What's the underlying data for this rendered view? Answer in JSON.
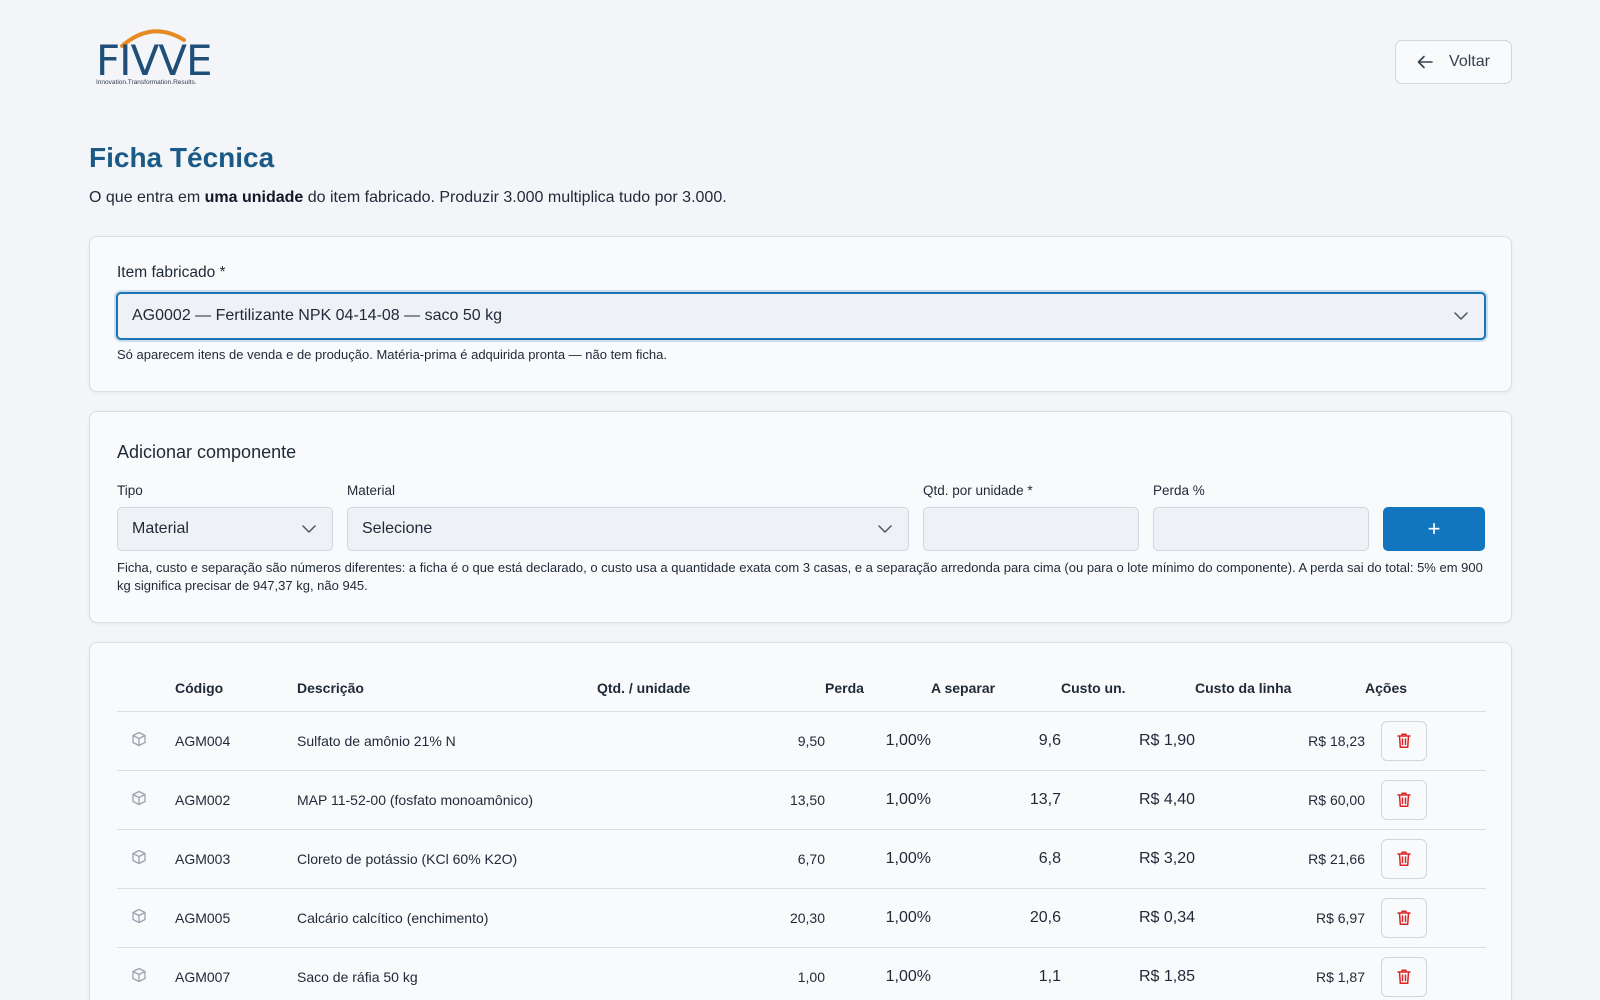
{
  "brand": {
    "logo_text": "FIVVE",
    "tagline": "Innovation.Transformation.Results.",
    "accent_color": "#e88a24",
    "primary_color": "#1b5a87"
  },
  "header": {
    "back_label": "Voltar",
    "back_icon": "arrow-left-icon"
  },
  "page": {
    "title": "Ficha Técnica",
    "subtitle_pre": "O que entra em ",
    "subtitle_bold": "uma unidade",
    "subtitle_post": " do item fabricado. Produzir 3.000 multiplica tudo por 3.000."
  },
  "item_select": {
    "label": "Item fabricado *",
    "value": "AG0002 — Fertilizante NPK 04-14-08 — saco 50 kg",
    "hint": "Só aparecem itens de venda e de produção. Matéria-prima é adquirida pronta — não tem ficha."
  },
  "add_component": {
    "title": "Adicionar componente",
    "tipo_label": "Tipo",
    "tipo_value": "Material",
    "material_label": "Material",
    "material_value": "Selecione",
    "qtd_label": "Qtd. por unidade *",
    "qtd_value": "",
    "perda_label": "Perda %",
    "perda_value": "",
    "add_button": "+",
    "hint": "Ficha, custo e separação são números diferentes: a ficha é o que está declarado, o custo usa a quantidade exata com 3 casas, e a separação arredonda para cima (ou para o lote mínimo do componente). A perda sai do total: 5% em 900 kg significa precisar de 947,37 kg, não 945."
  },
  "table": {
    "columns": [
      "Código",
      "Descrição",
      "Qtd. / unidade",
      "Perda",
      "A separar",
      "Custo un.",
      "Custo da linha",
      "Ações"
    ],
    "rows": [
      {
        "icon": "box-icon",
        "code": "AGM004",
        "desc": "Sulfato de amônio 21% N",
        "qtd": "9,50",
        "perda": "1,00%",
        "separar": "9,6",
        "custo_un": "R$ 1,90",
        "custo_linha": "R$ 18,23"
      },
      {
        "icon": "box-icon",
        "code": "AGM002",
        "desc": "MAP 11-52-00 (fosfato monoamônico)",
        "qtd": "13,50",
        "perda": "1,00%",
        "separar": "13,7",
        "custo_un": "R$ 4,40",
        "custo_linha": "R$ 60,00"
      },
      {
        "icon": "box-icon",
        "code": "AGM003",
        "desc": "Cloreto de potássio (KCl 60% K2O)",
        "qtd": "6,70",
        "perda": "1,00%",
        "separar": "6,8",
        "custo_un": "R$ 3,20",
        "custo_linha": "R$ 21,66"
      },
      {
        "icon": "box-icon",
        "code": "AGM005",
        "desc": "Calcário calcítico (enchimento)",
        "qtd": "20,30",
        "perda": "1,00%",
        "separar": "20,6",
        "custo_un": "R$ 0,34",
        "custo_linha": "R$ 6,97"
      },
      {
        "icon": "box-icon",
        "code": "AGM007",
        "desc": "Saco de ráfia 50 kg",
        "qtd": "1,00",
        "perda": "1,00%",
        "separar": "1,1",
        "custo_un": "R$ 1,85",
        "custo_linha": "R$ 1,87"
      }
    ]
  }
}
